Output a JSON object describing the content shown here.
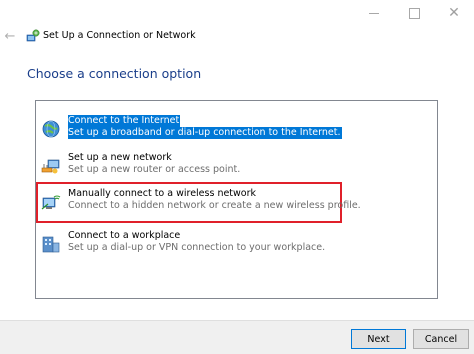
{
  "window": {
    "title": "Set Up a Connection or Network",
    "close_glyph": "✕"
  },
  "back_glyph": "←",
  "heading": "Choose a connection option",
  "options": [
    {
      "title": "Connect to the Internet",
      "description": "Set up a broadband or dial-up connection to the Internet.",
      "icon": "globe-network-icon",
      "state": "selected"
    },
    {
      "title": "Set up a new network",
      "description": "Set up a new router or access point.",
      "icon": "router-setup-icon",
      "state": "normal"
    },
    {
      "title": "Manually connect to a wireless network",
      "description": "Connect to a hidden network or create a new wireless profile.",
      "icon": "wireless-computer-icon",
      "state": "highlighted"
    },
    {
      "title": "Connect to a workplace",
      "description": "Set up a dial-up or VPN connection to your workplace.",
      "icon": "workplace-building-icon",
      "state": "normal"
    }
  ],
  "buttons": {
    "next": "Next",
    "cancel": "Cancel"
  },
  "colors": {
    "selection": "#0078d7",
    "heading": "#1a3e8a",
    "highlight_border": "#e0202a"
  }
}
